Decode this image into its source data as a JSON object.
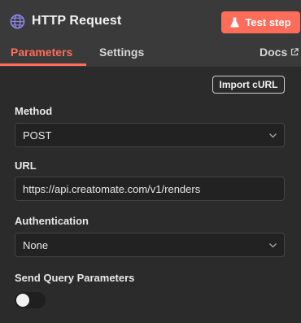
{
  "header": {
    "title": "HTTP Request",
    "node_icon": "globe-icon",
    "test_button": {
      "label": "Test step",
      "icon": "flask-icon"
    }
  },
  "tabs": [
    {
      "label": "Parameters",
      "active": true
    },
    {
      "label": "Settings",
      "active": false
    }
  ],
  "docs": {
    "label": "Docs",
    "icon": "external-link-icon"
  },
  "import_curl_label": "Import cURL",
  "fields": {
    "method": {
      "label": "Method",
      "value": "POST"
    },
    "url": {
      "label": "URL",
      "value": "https://api.creatomate.com/v1/renders"
    },
    "authentication": {
      "label": "Authentication",
      "value": "None"
    },
    "send_query": {
      "label": "Send Query Parameters",
      "enabled": false
    }
  },
  "colors": {
    "accent": "#ff6d5a",
    "header_bg": "#3a3a3a",
    "body_bg": "#2b2b2b",
    "input_bg": "#222222",
    "icon_purple": "#8f87f1"
  }
}
